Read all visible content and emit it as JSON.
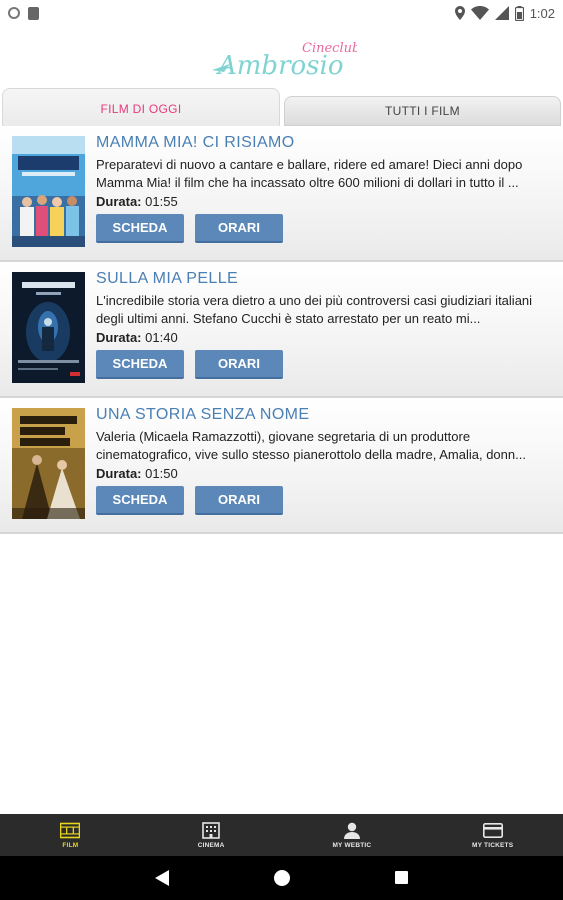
{
  "status_bar": {
    "time": "1:02",
    "icons": [
      "circle-icon",
      "sim-card-icon",
      "location-icon",
      "wifi-icon",
      "signal-icon",
      "battery-icon"
    ]
  },
  "header": {
    "logo_text_small": "Cineclub",
    "logo_text_large": "Ambrosio"
  },
  "tabs": [
    {
      "label": "FILM DI OGGI",
      "active": true
    },
    {
      "label": "TUTTI I FILM",
      "active": false
    }
  ],
  "films": [
    {
      "title": "MAMMA MIA! CI RISIAMO",
      "description": "Preparatevi di nuovo a cantare e ballare, ridere ed amare! Dieci anni dopo Mamma Mia! il film che ha incassato oltre 600 milioni di dollari in tutto il ...",
      "duration_label": "Durata:",
      "duration": "01:55",
      "scheda_label": "SCHEDA",
      "orari_label": "ORARI"
    },
    {
      "title": "SULLA MIA PELLE",
      "description": "L'incredibile storia vera dietro a uno dei più controversi casi giudiziari italiani degli ultimi anni. Stefano Cucchi è stato arrestato per un reato mi...",
      "duration_label": "Durata:",
      "duration": "01:40",
      "scheda_label": "SCHEDA",
      "orari_label": "ORARI"
    },
    {
      "title": "UNA STORIA SENZA NOME",
      "description": "Valeria (Micaela Ramazzotti), giovane segretaria di un produttore cinematografico, vive sullo stesso pianerottolo della madre, Amalia, donn...",
      "duration_label": "Durata:",
      "duration": "01:50",
      "scheda_label": "SCHEDA",
      "orari_label": "ORARI"
    }
  ],
  "bottom_nav": [
    {
      "label": "FILM",
      "icon": "film-icon",
      "active": true
    },
    {
      "label": "CINEMA",
      "icon": "building-icon",
      "active": false
    },
    {
      "label": "MY WEBTIC",
      "icon": "user-icon",
      "active": false
    },
    {
      "label": "MY TICKETS",
      "icon": "ticket-card-icon",
      "active": false
    }
  ],
  "colors": {
    "accent_pink": "#e8397b",
    "title_blue": "#4a7fb4",
    "button_blue": "#5b88b9",
    "nav_active": "#e9d51c",
    "logo_teal": "#7fd4d2"
  }
}
